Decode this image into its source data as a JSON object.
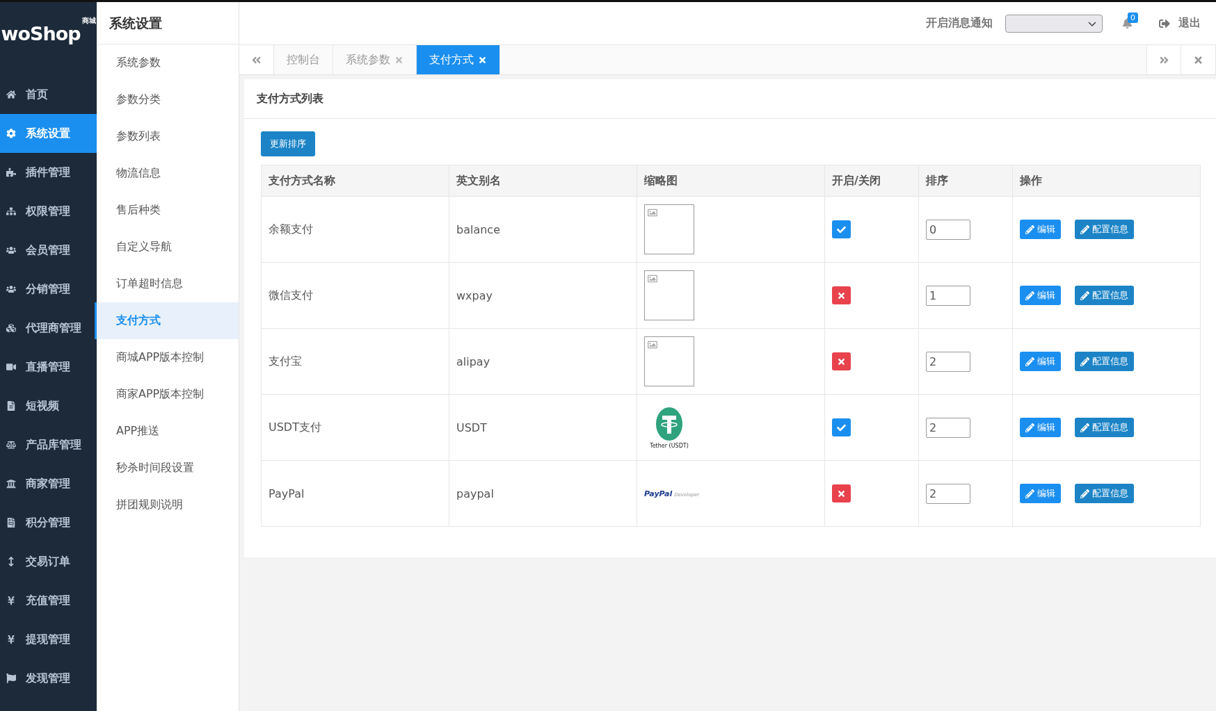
{
  "logo": {
    "name": "woShop",
    "tag": "商城"
  },
  "nav": [
    {
      "label": "首页",
      "selected": false
    },
    {
      "label": "系统设置",
      "selected": true
    },
    {
      "label": "插件管理",
      "selected": false
    },
    {
      "label": "权限管理",
      "selected": false
    },
    {
      "label": "会员管理",
      "selected": false
    },
    {
      "label": "分销管理",
      "selected": false
    },
    {
      "label": "代理商管理",
      "selected": false
    },
    {
      "label": "直播管理",
      "selected": false
    },
    {
      "label": "短视频",
      "selected": false
    },
    {
      "label": "产品库管理",
      "selected": false
    },
    {
      "label": "商家管理",
      "selected": false
    },
    {
      "label": "积分管理",
      "selected": false
    },
    {
      "label": "交易订单",
      "selected": false
    },
    {
      "label": "充值管理",
      "selected": false
    },
    {
      "label": "提现管理",
      "selected": false
    },
    {
      "label": "发现管理",
      "selected": false
    }
  ],
  "submenu": {
    "title": "系统设置",
    "items": [
      {
        "label": "系统参数",
        "selected": false
      },
      {
        "label": "参数分类",
        "selected": false
      },
      {
        "label": "参数列表",
        "selected": false
      },
      {
        "label": "物流信息",
        "selected": false
      },
      {
        "label": "售后种类",
        "selected": false
      },
      {
        "label": "自定义导航",
        "selected": false
      },
      {
        "label": "订单超时信息",
        "selected": false
      },
      {
        "label": "支付方式",
        "selected": true
      },
      {
        "label": "商城APP版本控制",
        "selected": false
      },
      {
        "label": "商家APP版本控制",
        "selected": false
      },
      {
        "label": "APP推送",
        "selected": false
      },
      {
        "label": "秒杀时间段设置",
        "selected": false
      },
      {
        "label": "拼团规则说明",
        "selected": false
      }
    ]
  },
  "header": {
    "notify_label": "开启消息通知",
    "badge": "0",
    "logout": "退出"
  },
  "tabs": [
    {
      "label": "控制台",
      "closable": false,
      "selected": false
    },
    {
      "label": "系统参数",
      "closable": true,
      "selected": false
    },
    {
      "label": "支付方式",
      "closable": true,
      "selected": true
    }
  ],
  "panel": {
    "title": "支付方式列表",
    "button": "更新排序"
  },
  "table": {
    "columns": [
      "支付方式名称",
      "英文别名",
      "缩略图",
      "开启/关闭",
      "排序",
      "操作"
    ],
    "rows": [
      {
        "name": "余额支付",
        "alias": "balance",
        "thumb": {
          "kind": "broken"
        },
        "enabled": true,
        "sort": "0",
        "actions": [
          "编辑",
          "配置信息"
        ]
      },
      {
        "name": "微信支付",
        "alias": "wxpay",
        "thumb": {
          "kind": "broken"
        },
        "enabled": false,
        "sort": "1",
        "actions": [
          "编辑",
          "配置信息"
        ]
      },
      {
        "name": "支付宝",
        "alias": "alipay",
        "thumb": {
          "kind": "broken"
        },
        "enabled": false,
        "sort": "2",
        "actions": [
          "编辑",
          "配置信息"
        ]
      },
      {
        "name": "USDT支付",
        "alias": "USDT",
        "thumb": {
          "kind": "tether",
          "caption": "Tether (USDT)"
        },
        "enabled": true,
        "sort": "2",
        "actions": [
          "编辑",
          "配置信息"
        ]
      },
      {
        "name": "PayPal",
        "alias": "paypal",
        "thumb": {
          "kind": "paypal",
          "brand": "PayPal",
          "caption": "Developer"
        },
        "enabled": false,
        "sort": "2",
        "actions": [
          "编辑",
          "配置信息"
        ]
      }
    ]
  }
}
